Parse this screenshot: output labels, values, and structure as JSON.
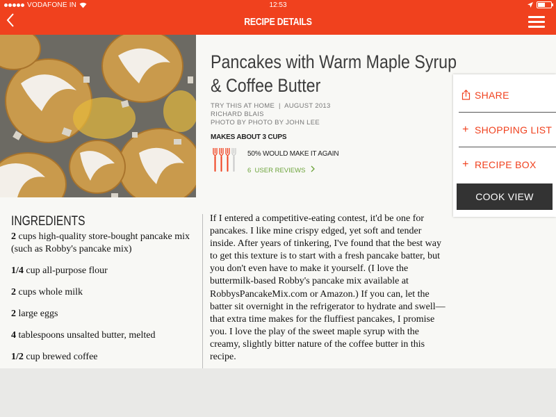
{
  "status_bar": {
    "carrier": "VODAFONE IN",
    "time": "12:53",
    "battery_level": 0.6
  },
  "header": {
    "title": "RECIPE DETAILS"
  },
  "recipe": {
    "title_line1": "Pancakes with Warm Maple Syrup",
    "title_line2": "& Coffee Butter",
    "source": "TRY THIS AT HOME  |  AUGUST 2013",
    "author": "RICHARD BLAIS",
    "photo_credit": "PHOTO BY PHOTO BY JOHN LEE",
    "makes": "MAKES ABOUT 3 CUPS",
    "would_make_again": "50% WOULD MAKE IT AGAIN",
    "forks_rating": {
      "filled": 3,
      "total": 4
    },
    "reviews_link": "6  USER REVIEWS",
    "forks_color": "#f0411e"
  },
  "side_panel": {
    "share": "SHARE",
    "shopping_list": "SHOPPING LIST",
    "recipe_box": "RECIPE BOX",
    "cook_view": "COOK VIEW"
  },
  "ingredients": {
    "heading": "INGREDIENTS",
    "items": [
      {
        "qty": "2",
        "text": " cups high-quality store-bought pancake mix (such as Robby's pancake mix)"
      },
      {
        "qty": "1/4",
        "text": " cup all-purpose flour"
      },
      {
        "qty": "2",
        "text": " cups whole milk"
      },
      {
        "qty": "2",
        "text": " large eggs"
      },
      {
        "qty": "4",
        "text": " tablespoons unsalted butter, melted"
      },
      {
        "qty": "1/2",
        "text": " cup brewed coffee"
      }
    ]
  },
  "description": "If I entered a competitive-eating contest, it'd be one for pancakes. I like mine crispy edged, yet soft and tender inside. After years of tinkering, I've found that the best way to get this texture is to start with a fresh pancake batter, but you don't even have to make it yourself. (I love the buttermilk-based Robby's pancake mix available at RobbysPancakeMix.com or Amazon.) If you can, let the batter sit overnight in the refrigerator to hydrate and swell—that extra time makes for the fluffiest pancakes, I promise you. I love the play of the sweet maple syrup with the creamy, slightly bitter nature of the coffee butter in this recipe.",
  "colors": {
    "accent": "#f0411e",
    "link_green": "#6ca33a",
    "cook_view_bg": "#333333"
  }
}
